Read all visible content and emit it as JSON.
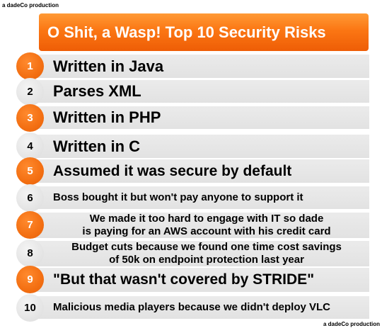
{
  "credits": {
    "top": "a dadeCo production",
    "bottom": "a dadeCo production"
  },
  "title": "O Shit, a Wasp! Top 10 Security Risks",
  "colors": {
    "accent_orange": "#f36f12",
    "row_gray": "#e6e6e6",
    "title_text": "#ffffff"
  },
  "items": [
    {
      "number": "1",
      "lines": [
        "Written in Java"
      ],
      "highlight": true
    },
    {
      "number": "2",
      "lines": [
        "Parses XML"
      ],
      "highlight": false
    },
    {
      "number": "3",
      "lines": [
        "Written in PHP"
      ],
      "highlight": true
    },
    {
      "number": "4",
      "lines": [
        "Written in C"
      ],
      "highlight": false
    },
    {
      "number": "5",
      "lines": [
        "Assumed it was secure by default"
      ],
      "highlight": true
    },
    {
      "number": "6",
      "lines": [
        "Boss bought it but won't pay anyone to support it"
      ],
      "highlight": false
    },
    {
      "number": "7",
      "lines": [
        "We made it too hard to engage with IT so dade",
        "is paying for an AWS account with his credit card"
      ],
      "highlight": true
    },
    {
      "number": "8",
      "lines": [
        "Budget cuts because we found one time cost savings",
        "of 50k on endpoint protection last year"
      ],
      "highlight": false
    },
    {
      "number": "9",
      "lines": [
        "\"But that wasn't covered by STRIDE\""
      ],
      "highlight": true
    },
    {
      "number": "10",
      "lines": [
        "Malicious media players because we didn't deploy VLC"
      ],
      "highlight": false
    }
  ]
}
